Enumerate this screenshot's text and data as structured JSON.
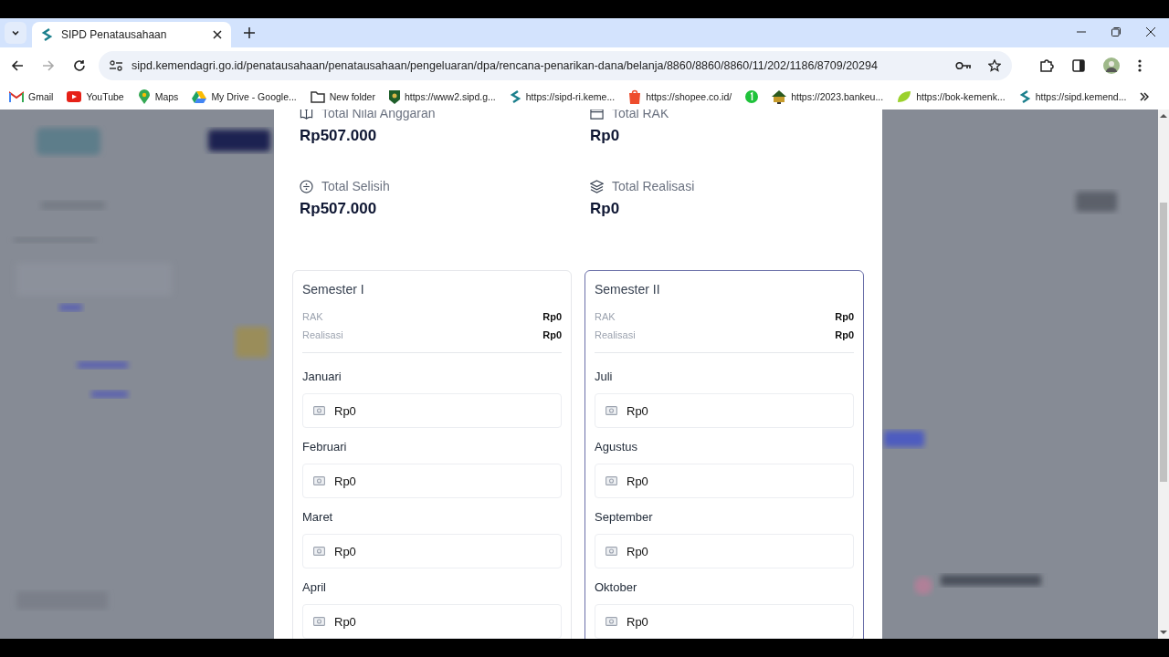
{
  "browser": {
    "tabs": [
      {
        "title": "SIPD Penatausahaan",
        "selected": true
      }
    ],
    "forward_disabled": true,
    "url": "sipd.kemendagri.go.id/penatausahaan/penatausahaan/pengeluaran/dpa/rencana-penarikan-dana/belanja/8860/8860/8860/11/202/1186/8709/20294",
    "bookmarks": [
      {
        "label": "Gmail"
      },
      {
        "label": "YouTube"
      },
      {
        "label": "Maps"
      },
      {
        "label": "My Drive - Google..."
      },
      {
        "label": "New folder"
      },
      {
        "label": "https://www2.sipd.g..."
      },
      {
        "label": "https://sipd-ri.keme..."
      },
      {
        "label": "https://shopee.co.id/"
      },
      {
        "label": "https://2023.bankeu..."
      },
      {
        "label": "https://bok-kemenk..."
      },
      {
        "label": "https://sipd.kemend..."
      }
    ]
  },
  "summary": [
    {
      "label": "Total Nilai Anggaran",
      "value": "Rp507.000"
    },
    {
      "label": "Total RAK",
      "value": "Rp0"
    },
    {
      "label": "Total Selisih",
      "value": "Rp507.000"
    },
    {
      "label": "Total Realisasi",
      "value": "Rp0"
    }
  ],
  "semesters": [
    {
      "title": "Semester I",
      "selected": false,
      "rak_label": "RAK",
      "rak": "Rp0",
      "realisasi_label": "Realisasi",
      "realisasi": "Rp0",
      "months": [
        {
          "name": "Januari",
          "value": "Rp0"
        },
        {
          "name": "Februari",
          "value": "Rp0"
        },
        {
          "name": "Maret",
          "value": "Rp0"
        },
        {
          "name": "April",
          "value": "Rp0"
        }
      ]
    },
    {
      "title": "Semester II",
      "selected": true,
      "rak_label": "RAK",
      "rak": "Rp0",
      "realisasi_label": "Realisasi",
      "realisasi": "Rp0",
      "months": [
        {
          "name": "Juli",
          "value": "Rp0"
        },
        {
          "name": "Agustus",
          "value": "Rp0"
        },
        {
          "name": "September",
          "value": "Rp0"
        },
        {
          "name": "Oktober",
          "value": "Rp0"
        }
      ]
    }
  ]
}
